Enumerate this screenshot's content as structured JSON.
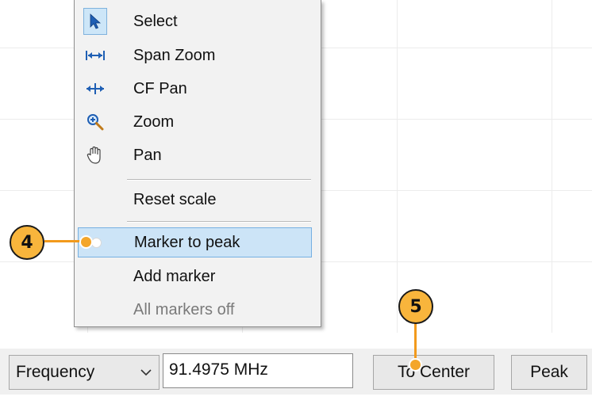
{
  "context_menu": {
    "tools": [
      {
        "label": "Select",
        "icon": "arrow-pointer-icon"
      },
      {
        "label": "Span Zoom",
        "icon": "span-zoom-icon"
      },
      {
        "label": "CF Pan",
        "icon": "cf-pan-icon"
      },
      {
        "label": "Zoom",
        "icon": "magnifier-icon"
      },
      {
        "label": "Pan",
        "icon": "hand-icon"
      }
    ],
    "reset_scale": "Reset scale",
    "marker_to_peak": "Marker to peak",
    "add_marker": "Add marker",
    "all_markers_off": "All markers off"
  },
  "callouts": {
    "step4": "4",
    "step5": "5"
  },
  "toolbar": {
    "measure_select": "Frequency",
    "value_input": "91.4975 MHz",
    "to_center_label": "To Center",
    "peak_label": "Peak"
  },
  "colors": {
    "callout_fill": "#f8b53c",
    "highlight": "#cce4f7",
    "icon_blue": "#1f5fb4"
  }
}
